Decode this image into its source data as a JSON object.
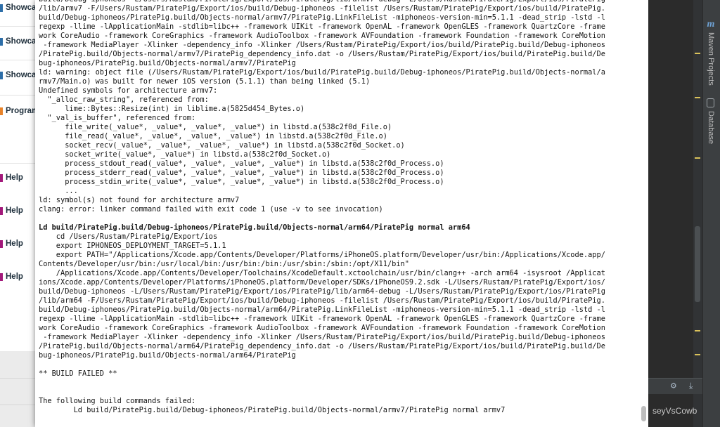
{
  "left_panel": {
    "items": [
      {
        "label": "Showca",
        "color": "#2d6ea8"
      },
      {
        "label": "Showca",
        "color": "#2d6ea8"
      },
      {
        "label": "Showca",
        "color": "#2d6ea8"
      },
      {
        "label": "Program",
        "color": "#e8832a"
      },
      {
        "label": "Help",
        "color": "#a2187a"
      },
      {
        "label": "Help",
        "color": "#a2187a"
      },
      {
        "label": "Help",
        "color": "#a2187a"
      },
      {
        "label": "Help",
        "color": "#a2187a"
      }
    ]
  },
  "console": {
    "lines": [
      "build/Debug-iphoneos -L/Users/Rustam/PiratePig/Export/ios/PiratePig/lib/armv7-debug -L/Users/Rustam/PiratePig/Export/ios/PiratePig",
      "/lib/armv7 -F/Users/Rustam/PiratePig/Export/ios/build/Debug-iphoneos -filelist /Users/Rustam/PiratePig/Export/ios/build/PiratePig.",
      "build/Debug-iphoneos/PiratePig.build/Objects-normal/armv7/PiratePig.LinkFileList -miphoneos-version-min=5.1.1 -dead_strip -lstd -l",
      "regexp -llime -lApplicationMain -stdlib=libc++ -framework UIKit -framework OpenAL -framework OpenGLES -framework QuartzCore -frame",
      "work CoreAudio -framework CoreGraphics -framework AudioToolbox -framework AVFoundation -framework Foundation -framework CoreMotion",
      " -framework MediaPlayer -Xlinker -dependency_info -Xlinker /Users/Rustam/PiratePig/Export/ios/build/PiratePig.build/Debug-iphoneos",
      "/PiratePig.build/Objects-normal/armv7/PiratePig_dependency_info.dat -o /Users/Rustam/PiratePig/Export/ios/build/PiratePig.build/De",
      "bug-iphoneos/PiratePig.build/Objects-normal/armv7/PiratePig",
      "ld: warning: object file (/Users/Rustam/PiratePig/Export/ios/build/PiratePig.build/Debug-iphoneos/PiratePig.build/Objects-normal/a",
      "rmv7/Main.o) was built for newer iOS version (5.1.1) than being linked (5.1)",
      "Undefined symbols for architecture armv7:",
      "  \"_alloc_raw_string\", referenced from:",
      "      lime::Bytes::Resize(int) in liblime.a(5825d454_Bytes.o)",
      "  \"_val_is_buffer\", referenced from:",
      "      file_write(_value*, _value*, _value*, _value*) in libstd.a(538c2f0d_File.o)",
      "      file_read(_value*, _value*, _value*, _value*) in libstd.a(538c2f0d_File.o)",
      "      socket_recv(_value*, _value*, _value*, _value*) in libstd.a(538c2f0d_Socket.o)",
      "      socket_write(_value*, _value*) in libstd.a(538c2f0d_Socket.o)",
      "      process_stdout_read(_value*, _value*, _value*, _value*) in libstd.a(538c2f0d_Process.o)",
      "      process_stderr_read(_value*, _value*, _value*, _value*) in libstd.a(538c2f0d_Process.o)",
      "      process_stdin_write(_value*, _value*, _value*, _value*) in libstd.a(538c2f0d_Process.o)",
      "      ...",
      "ld: symbol(s) not found for architecture armv7",
      "clang: error: linker command failed with exit code 1 (use -v to see invocation)",
      "",
      "Ld build/PiratePig.build/Debug-iphoneos/PiratePig.build/Objects-normal/arm64/PiratePig normal arm64",
      "    cd /Users/Rustam/PiratePig/Export/ios",
      "    export IPHONEOS_DEPLOYMENT_TARGET=5.1.1",
      "    export PATH=\"/Applications/Xcode.app/Contents/Developer/Platforms/iPhoneOS.platform/Developer/usr/bin:/Applications/Xcode.app/",
      "Contents/Developer/usr/bin:/usr/local/bin:/usr/bin:/bin:/usr/sbin:/sbin:/opt/X11/bin\"",
      "    /Applications/Xcode.app/Contents/Developer/Toolchains/XcodeDefault.xctoolchain/usr/bin/clang++ -arch arm64 -isysroot /Applicat",
      "ions/Xcode.app/Contents/Developer/Platforms/iPhoneOS.platform/Developer/SDKs/iPhoneOS9.2.sdk -L/Users/Rustam/PiratePig/Export/ios/",
      "build/Debug-iphoneos -L/Users/Rustam/PiratePig/Export/ios/PiratePig/lib/arm64-debug -L/Users/Rustam/PiratePig/Export/ios/PiratePig",
      "/lib/arm64 -F/Users/Rustam/PiratePig/Export/ios/build/Debug-iphoneos -filelist /Users/Rustam/PiratePig/Export/ios/build/PiratePig.",
      "build/Debug-iphoneos/PiratePig.build/Objects-normal/arm64/PiratePig.LinkFileList -miphoneos-version-min=5.1.1 -dead_strip -lstd -l",
      "regexp -llime -lApplicationMain -stdlib=libc++ -framework UIKit -framework OpenAL -framework OpenGLES -framework QuartzCore -frame",
      "work CoreAudio -framework CoreGraphics -framework AudioToolbox -framework AVFoundation -framework Foundation -framework CoreMotion",
      " -framework MediaPlayer -Xlinker -dependency_info -Xlinker /Users/Rustam/PiratePig/Export/ios/build/PiratePig.build/Debug-iphoneos",
      "/PiratePig.build/Objects-normal/arm64/PiratePig_dependency_info.dat -o /Users/Rustam/PiratePig/Export/ios/build/PiratePig.build/De",
      "bug-iphoneos/PiratePig.build/Objects-normal/arm64/PiratePig",
      "",
      "** BUILD FAILED **",
      "",
      "",
      "The following build commands failed:",
      "\tLd build/PiratePig.build/Debug-iphoneos/PiratePig.build/Objects-normal/armv7/PiratePig normal armv7"
    ],
    "bold_lines": [
      25,
      46
    ],
    "error_lines": [
      42
    ]
  },
  "right_panel": {
    "tool_windows": [
      {
        "label": "Maven Projects",
        "icon": "maven-icon"
      },
      {
        "label": "Database",
        "icon": "database-icon"
      }
    ],
    "run_label": "seyVsCowb",
    "gutter_mark_color": "#d9c15a"
  }
}
